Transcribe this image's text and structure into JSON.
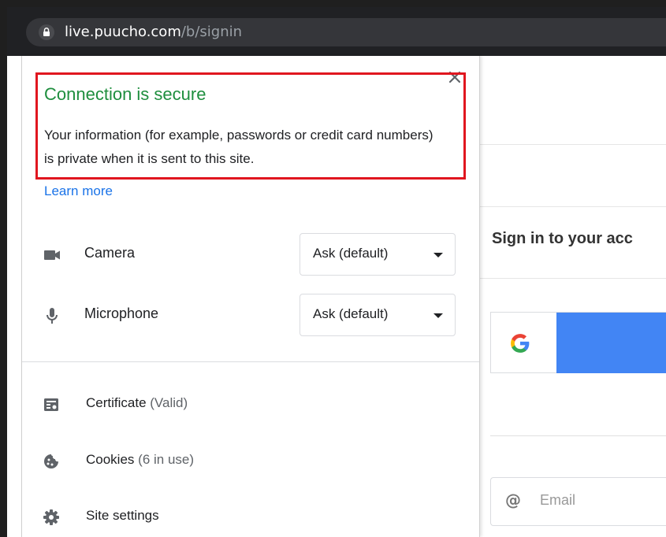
{
  "address_bar": {
    "url_host": "live.puucho.com",
    "url_path": "/b/signin",
    "icon": "lock-icon"
  },
  "page": {
    "signin_title": "Sign in to your acc",
    "google_button_icon": "google-g-icon",
    "email_placeholder": "Email",
    "email_icon": "@"
  },
  "popup": {
    "close_icon": "close-icon",
    "title": "Connection is secure",
    "description": "Your information (for example, passwords or credit card numbers) is private when it is sent to this site.",
    "learn_more": "Learn more",
    "permissions": [
      {
        "label": "Camera",
        "icon": "camera-icon",
        "value": "Ask (default)"
      },
      {
        "label": "Microphone",
        "icon": "microphone-icon",
        "value": "Ask (default)"
      }
    ],
    "info_items": [
      {
        "label": "Certificate",
        "sub": "(Valid)",
        "icon": "certificate-icon"
      },
      {
        "label": "Cookies",
        "sub": "(6 in use)",
        "icon": "cookie-icon"
      },
      {
        "label": "Site settings",
        "sub": "",
        "icon": "gear-icon"
      }
    ]
  },
  "colors": {
    "secure_green": "#1e8e3e",
    "link_blue": "#1a73e8",
    "highlight_red": "#e0161f",
    "google_blue": "#4285f4",
    "toolbar_dark": "#202124"
  }
}
